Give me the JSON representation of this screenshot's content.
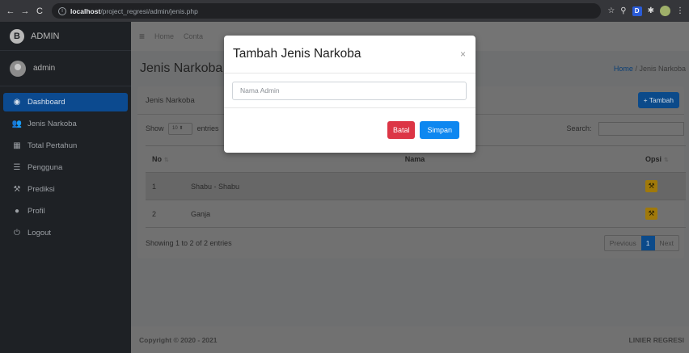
{
  "browser": {
    "url_host": "localhost",
    "url_path": "/project_regresi/admin/jenis.php"
  },
  "sidebar": {
    "brand": "ADMIN",
    "user": "admin",
    "items": [
      {
        "label": "Dashboard",
        "icon": "dashboard-icon",
        "active": true
      },
      {
        "label": "Jenis Narkoba",
        "icon": "users-icon",
        "active": false
      },
      {
        "label": "Total Pertahun",
        "icon": "calendar-icon",
        "active": false
      },
      {
        "label": "Pengguna",
        "icon": "list-icon",
        "active": false
      },
      {
        "label": "Prediksi",
        "icon": "wrench-icon",
        "active": false
      },
      {
        "label": "Profil",
        "icon": "user-icon",
        "active": false
      },
      {
        "label": "Logout",
        "icon": "power-icon",
        "active": false
      }
    ]
  },
  "topbar": {
    "home": "Home",
    "contact": "Conta"
  },
  "header": {
    "title": "Jenis Narkoba",
    "breadcrumb_home": "Home",
    "breadcrumb_sep": "/",
    "breadcrumb_current": "Jenis Narkoba"
  },
  "card": {
    "title": "Jenis Narkoba",
    "add_button": "Tambah",
    "show_label": "Show",
    "show_value": "10",
    "entries_label": "entries",
    "search_label": "Search:",
    "columns": [
      "No",
      "Nama",
      "Opsi"
    ],
    "rows": [
      {
        "no": "1",
        "nama": "Shabu - Shabu"
      },
      {
        "no": "2",
        "nama": "Ganja"
      }
    ],
    "info": "Showing 1 to 2 of 2 entries",
    "pager": {
      "previous": "Previous",
      "current": "1",
      "next": "Next"
    }
  },
  "footer": {
    "copyright": "Copyright © 2020 - 2021",
    "brand": "LINIER REGRESI"
  },
  "modal": {
    "title": "Tambah Jenis Narkoba",
    "close": "×",
    "input_placeholder": "Nama Admin",
    "cancel_button": "Batal",
    "save_button": "Simpan"
  },
  "colors": {
    "danger": "#dc3545",
    "primary": "#0d87f0",
    "warning": "#ffc107"
  }
}
